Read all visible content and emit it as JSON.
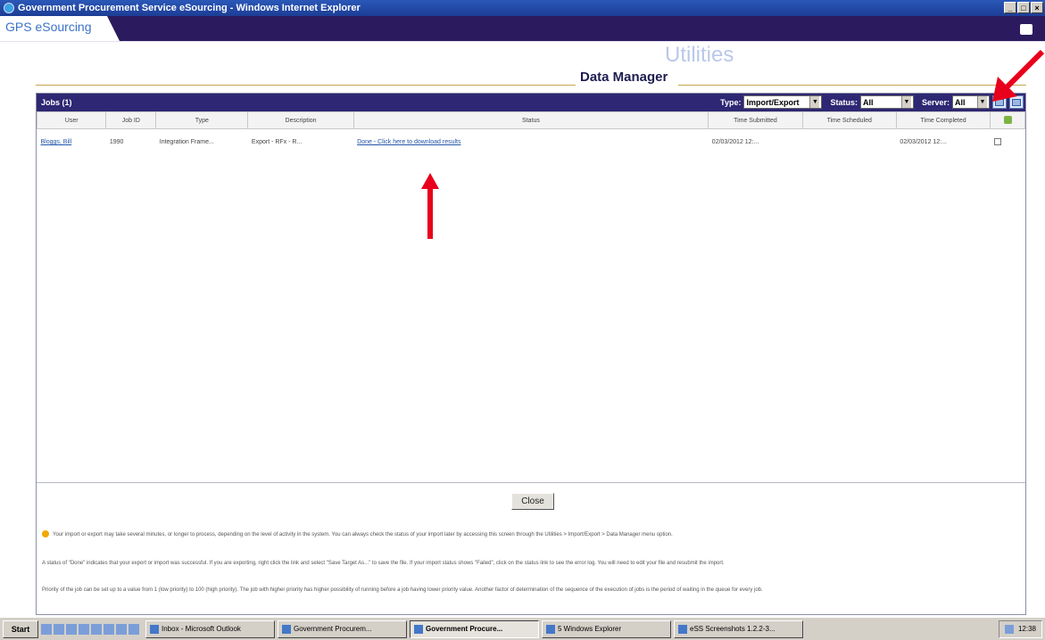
{
  "window": {
    "title": "Government Procurement Service eSourcing - Windows Internet Explorer",
    "min": "_",
    "max": "□",
    "close": "×"
  },
  "app": {
    "brand": "GPS eSourcing",
    "watermark": "Utilities",
    "page_title": "Data Manager"
  },
  "panel": {
    "title": "Jobs (1)",
    "filters": {
      "type_label": "Type:",
      "type_value": "Import/Export",
      "status_label": "Status:",
      "status_value": "All",
      "server_label": "Server:",
      "server_value": "All"
    },
    "columns": [
      "User",
      "Job ID",
      "Type",
      "Description",
      "Status",
      "Time Submitted",
      "Time Scheduled",
      "Time Completed"
    ],
    "rows": [
      {
        "user": "Bloggs, Bill",
        "job_id": "1990",
        "type": "Integration Frame...",
        "description": "Export - RFx - R...",
        "status": "Done - Click here to download results",
        "submitted": "02/03/2012 12:...",
        "scheduled": "",
        "completed": "02/03/2012 12:..."
      }
    ]
  },
  "close_label": "Close",
  "notes": [
    "Your import or export may take several minutes, or longer to process, depending on the level of activity in the system. You can always check the status of your import later by accessing this screen through the Utilities > Import/Export > Data Manager menu option.",
    "A status of \"Done\" indicates that your export or import was successful. If you are exporting, right click the link and select \"Save Target As...\" to save the file. If your import status shows \"Failed\", click on the status link to see the error log. You will need to edit your file and resubmit the import.",
    "Priority of the job can be set up to a value from 1 (low priority) to 100 (high priority). The job with higher priority has higher possibility of running before a job having lower priority value. Another factor of determination of the sequence of the execution of jobs is the period of waiting in the queue for every job."
  ],
  "taskbar": {
    "start": "Start",
    "tasks": [
      {
        "label": "Inbox - Microsoft Outlook",
        "active": false
      },
      {
        "label": "Government Procurem...",
        "active": false
      },
      {
        "label": "Government Procure...",
        "active": true
      },
      {
        "label": "5 Windows Explorer",
        "active": false
      },
      {
        "label": "eSS Screenshots 1.2.2-3...",
        "active": false
      }
    ],
    "clock": "12:38"
  },
  "colors": {
    "panel_header": "#2e2773",
    "brand_bar": "#2b1b5e",
    "annotation_arrow": "#e8001c"
  }
}
